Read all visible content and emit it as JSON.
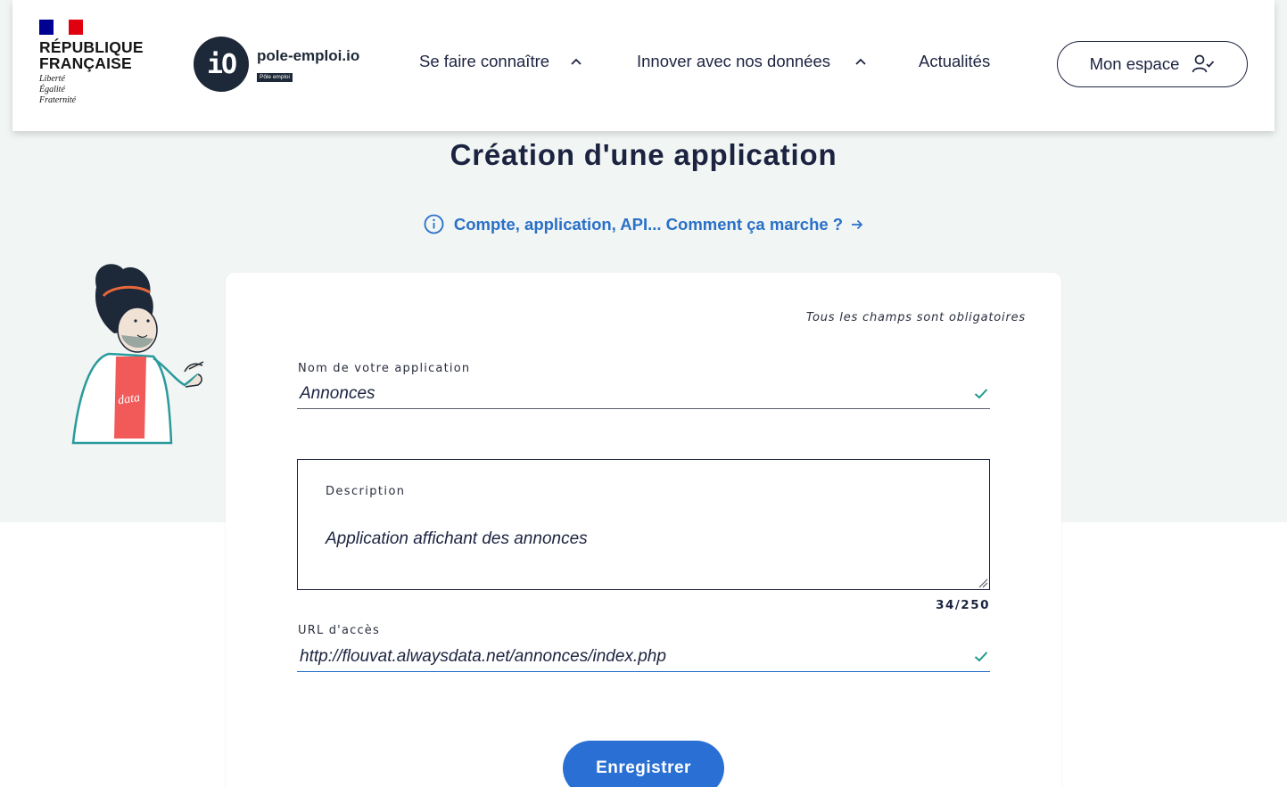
{
  "header": {
    "republique_line1": "RÉPUBLIQUE",
    "republique_line2": "FRANÇAISE",
    "motto_1": "Liberté",
    "motto_2": "Égalité",
    "motto_3": "Fraternité",
    "brand_name": "pole-emploi.io",
    "brand_badge": "Pôle emploi",
    "nav": [
      {
        "label": "Se faire connaître",
        "icon": "chevron-up-icon"
      },
      {
        "label": "Innover avec nos données",
        "icon": "chevron-up-icon"
      },
      {
        "label": "Actualités"
      }
    ],
    "account_button": "Mon espace"
  },
  "page": {
    "title": "Création d'une application",
    "help_link": "Compte, application, API... Comment ça marche ?"
  },
  "illustration": {
    "shirt_text": "data"
  },
  "form": {
    "required_note": "Tous les champs sont obligatoires",
    "name_label": "Nom de votre application",
    "name_value": "Annonces",
    "description_label": "Description",
    "description_value": "Application affichant des annonces",
    "description_counter": "34/250",
    "url_label": "URL d'accès",
    "url_value": "http://flouvat.alwaysdata.net/annonces/index.php",
    "submit_label": "Enregistrer"
  },
  "colors": {
    "primary_blue": "#2a70d4",
    "navy": "#1c2340",
    "valid_teal": "#1a9a8a",
    "background_tint": "#f1f5f3"
  }
}
